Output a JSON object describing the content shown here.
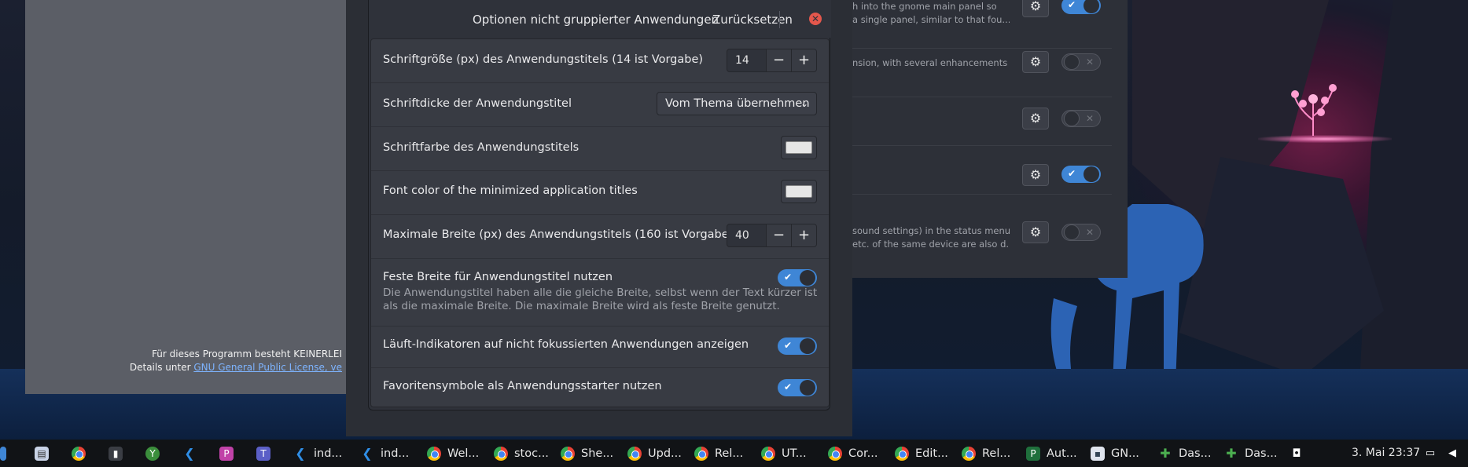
{
  "dialog": {
    "title": "Optionen nicht gruppierter Anwendungen",
    "reset_label": "Zurücksetzen",
    "close_symbol": "✕",
    "rows": [
      {
        "label": "Schriftgröße (px) des Anwendungstitels (14 ist Vorgabe)",
        "value": "14"
      },
      {
        "label": "Schriftdicke der Anwendungstitel",
        "value": "Vom Thema übernehmen"
      },
      {
        "label": "Schriftfarbe des Anwendungstitels",
        "color": "#e6e6e6"
      },
      {
        "label": "Font color of the minimized application titles",
        "color": "#e6e6e6"
      },
      {
        "label": "Maximale Breite (px) des Anwendungstitels (160 ist Vorgabe)",
        "value": "40"
      },
      {
        "label": "Feste Breite für Anwendungstitel nutzen",
        "description": "Die Anwendungstitel haben alle die gleiche Breite, selbst wenn der Text kürzer ist als die maximale Breite. Die maximale Breite wird als feste Breite genutzt.",
        "enabled": true
      },
      {
        "label": "Läuft-Indikatoren auf nicht fokussierten Anwendungen anzeigen",
        "enabled": true
      },
      {
        "label": "Favoritensymbole als Anwendungsstarter nutzen",
        "enabled": true
      }
    ],
    "spin_minus": "−",
    "spin_plus": "+",
    "toggle_mark": "✔"
  },
  "left_window": {
    "license_line1": "Für dieses Programm besteht KEINERLEI",
    "license_prefix": "Details unter ",
    "license_link": "GNU General Public License, ve"
  },
  "right_window": {
    "rows": [
      {
        "desc1": "h into the gnome main panel so",
        "desc2": "a single panel, similar to that fou...",
        "enabled": true
      },
      {
        "desc1": "nsion, with several enhancements .",
        "desc2": "",
        "enabled": false
      },
      {
        "desc1": "",
        "desc2": "",
        "enabled": false
      },
      {
        "desc1": "",
        "desc2": "",
        "enabled": true
      },
      {
        "desc1": "sound settings) in the status menu",
        "desc2": "etc. of the same device are also d...",
        "enabled": false
      }
    ]
  },
  "taskbar": {
    "items": [
      {
        "label": "ind..."
      },
      {
        "label": "ind..."
      },
      {
        "label": "Wel..."
      },
      {
        "label": "stoc..."
      },
      {
        "label": "She..."
      },
      {
        "label": "Upd..."
      },
      {
        "label": "Rel..."
      },
      {
        "label": "UT..."
      },
      {
        "label": "Cor..."
      },
      {
        "label": "Edit..."
      },
      {
        "label": "Rel..."
      },
      {
        "label": "Aut..."
      },
      {
        "label": "GN..."
      },
      {
        "label": "Das..."
      },
      {
        "label": "Das..."
      }
    ],
    "clock": "3. Mai  23:37"
  },
  "colors": {
    "accent": "#3f86d6",
    "close": "#e4574c",
    "panel": "#383b43"
  }
}
